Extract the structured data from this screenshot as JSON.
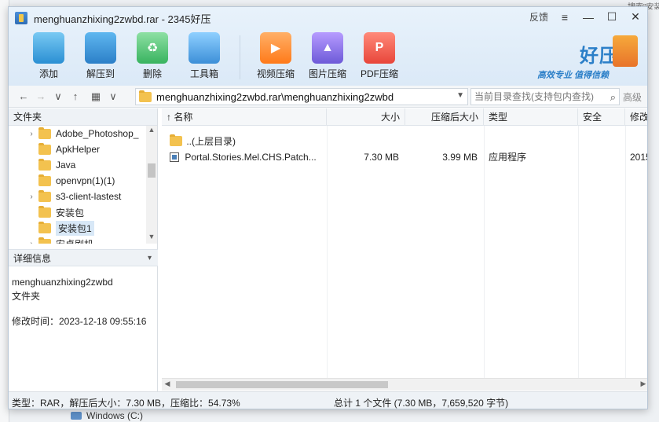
{
  "window": {
    "title": "menghuanzhixing2zwbd.rar - 2345好压",
    "feedback": "反馈",
    "menu_glyph": "≡",
    "minimize_glyph": "—",
    "maximize_glyph": "☐",
    "close_glyph": "✕"
  },
  "toolbar": {
    "add": "添加",
    "extract": "解压到",
    "delete": "删除",
    "toolbox": "工具箱",
    "video_compress": "视频压缩",
    "image_compress": "图片压缩",
    "pdf_compress": "PDF压缩"
  },
  "brand": {
    "name": "好压",
    "slogan": "高效专业 值得信赖"
  },
  "address": {
    "back": "←",
    "forward": "→",
    "history": "∨",
    "up": "↑",
    "view": "▦",
    "view_drop": "∨",
    "path": "menghuanzhixing2zwbd.rar\\menghuanzhixing2zwbd",
    "search_placeholder": "当前目录查找(支持包内查找)",
    "search_glyph": "⌕",
    "advanced": "高级"
  },
  "left_pane": {
    "folders_header": "文件夹",
    "tree": [
      {
        "label": "Adobe_Photoshop_",
        "expand": "›"
      },
      {
        "label": "ApkHelper",
        "expand": ""
      },
      {
        "label": "Java",
        "expand": ""
      },
      {
        "label": "openvpn(1)(1)",
        "expand": ""
      },
      {
        "label": "s3-client-lastest",
        "expand": "›"
      },
      {
        "label": "安装包",
        "expand": ""
      },
      {
        "label": "安装包1",
        "expand": "",
        "selected": true
      },
      {
        "label": "安卓刷机",
        "expand": "›"
      }
    ],
    "details_header": "详细信息",
    "details_caret": "▾",
    "detail_name": "menghuanzhixing2zwbd",
    "detail_type": "文件夹",
    "detail_modified": "修改时间：2023-12-18 09:55:16"
  },
  "file_list": {
    "columns": {
      "name": "名称",
      "size": "大小",
      "packed": "压缩后大小",
      "type": "类型",
      "security": "安全",
      "modified": "修改时"
    },
    "sort_indicator": "↑",
    "rows": [
      {
        "name": "..(上层目录)",
        "size": "",
        "packed": "",
        "type": "",
        "modified": ""
      },
      {
        "name": "Portal.Stories.Mel.CHS.Patch...",
        "size": "7.30 MB",
        "packed": "3.99 MB",
        "type": "应用程序",
        "modified": "2015-"
      }
    ]
  },
  "status": {
    "left": "类型：RAR，解压后大小：7.30 MB，压缩比：54.73%",
    "right": "总计 1 个文件 (7.30 MB，7,659,520 字节)"
  },
  "background": {
    "drive_label": "Windows (C:)",
    "topright_text": "搜索\"安装"
  }
}
